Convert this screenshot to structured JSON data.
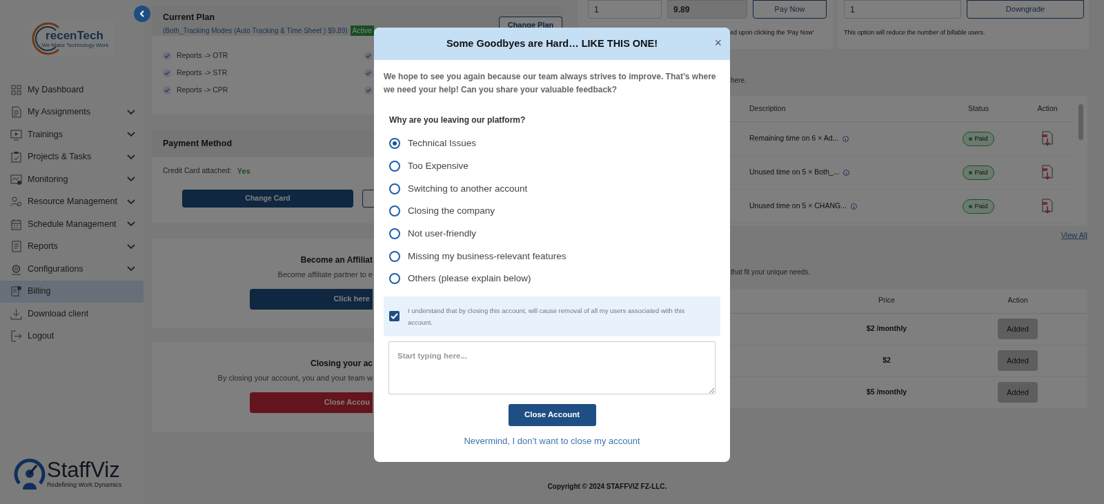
{
  "sidebar": {
    "logo": {
      "name": "recenTech",
      "tagline": "We Make Technology Work"
    },
    "items": [
      {
        "label": "My Dashboard",
        "has_submenu": false,
        "selected": false
      },
      {
        "label": "My Assignments",
        "has_submenu": true,
        "selected": false
      },
      {
        "label": "Trainings",
        "has_submenu": true,
        "selected": false
      },
      {
        "label": "Projects & Tasks",
        "has_submenu": true,
        "selected": false
      },
      {
        "label": "Monitoring",
        "has_submenu": true,
        "selected": false
      },
      {
        "label": "Resource Management",
        "has_submenu": true,
        "selected": false
      },
      {
        "label": "Schedule Management",
        "has_submenu": true,
        "selected": false
      },
      {
        "label": "Reports",
        "has_submenu": true,
        "selected": false
      },
      {
        "label": "Configurations",
        "has_submenu": true,
        "selected": false
      },
      {
        "label": "Billing",
        "has_submenu": false,
        "selected": true
      },
      {
        "label": "Download client",
        "has_submenu": false,
        "selected": false
      },
      {
        "label": "Logout",
        "has_submenu": false,
        "selected": false
      }
    ],
    "brand": {
      "name": "StaffViz",
      "tagline": "Redefining Work Dynamics"
    }
  },
  "current_plan": {
    "title": "Current Plan",
    "plan": "(Both_Tracking Modes (Auto Tracking & Time Sheet ) $9.89)",
    "status": "Active",
    "button": "Change Plan",
    "features": [
      {
        "label": "Reports -> OTR"
      },
      {
        "label": "Reports -> STR"
      },
      {
        "label": "Reports -> CPR"
      }
    ]
  },
  "payment_method": {
    "title": "Payment Method",
    "card_label": "Credit Card attached:",
    "card_value": "Yes",
    "button": "Change Card"
  },
  "affiliate": {
    "title": "Become an Affiliat",
    "text": "Become affiliate partner to e",
    "button": "Click here"
  },
  "closing": {
    "title": "Closing your ac",
    "text": "By closing your account, you and your team w",
    "button": "Close Accou"
  },
  "pay": {
    "quantity": "1",
    "amount": "9.89",
    "button": "Pay Now",
    "note": "ed upon clicking the 'Pay Now'"
  },
  "downgrade": {
    "quantity": "1",
    "button": "Downgrade",
    "note": "This option will reduce the number of billable users."
  },
  "invoices": {
    "note": "here.",
    "columns": [
      "Description",
      "Status",
      "Action"
    ],
    "rows": [
      {
        "description": "Remaining time on 6 × Ad...",
        "status": "Paid"
      },
      {
        "description": "Unused time on 5 × Both_...",
        "status": "Paid"
      },
      {
        "description": "Unused time on 5 × CHANG...",
        "status": "Paid"
      }
    ],
    "view_all": "View All"
  },
  "addons": {
    "note": "that fit your unique needs.",
    "columns": [
      "Price",
      "Action"
    ],
    "rows": [
      {
        "price": "$2 /monthly",
        "action": "Added"
      },
      {
        "price": "$2",
        "action": "Added"
      },
      {
        "price": "$5 /monthly",
        "action": "Added"
      }
    ]
  },
  "footer": {
    "copyright": "Copyright © 2024 STAFFVIZ FZ-LLC."
  },
  "modal": {
    "title": "Some Goodbyes are Hard… LIKE THIS ONE!",
    "close": "×",
    "intro": "We hope to see you again because our team always strives to improve. That’s where we need your help! Can you share your valuable feedback?",
    "question": "Why are you leaving our platform?",
    "reasons": [
      {
        "label": "Technical Issues",
        "selected": true
      },
      {
        "label": "Too Expensive",
        "selected": false
      },
      {
        "label": "Switching to another account",
        "selected": false
      },
      {
        "label": "Closing the company",
        "selected": false
      },
      {
        "label": "Not user-friendly",
        "selected": false
      },
      {
        "label": "Missing my business-relevant features",
        "selected": false
      },
      {
        "label": "Others (please explain below)",
        "selected": false
      }
    ],
    "consent": {
      "text": "I understand that by closing this account, will cause removal of all my users associated with this account.",
      "checked": true
    },
    "feedback": {
      "placeholder": "Start typing here..."
    },
    "submit": "Close Account",
    "cancel": "Nevermind, I don’t want to close my account"
  }
}
